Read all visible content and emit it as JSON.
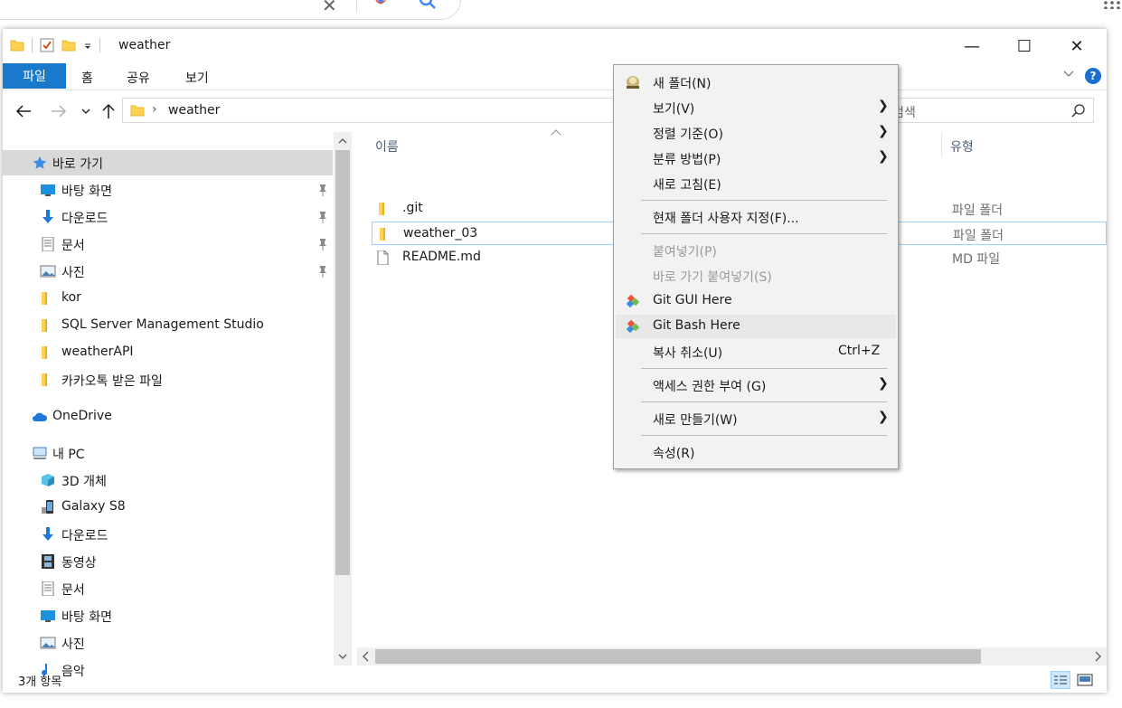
{
  "window": {
    "title": "weather",
    "minimize": "—",
    "maximize": "☐",
    "close": "✕"
  },
  "ribbon": {
    "tabs": [
      "파일",
      "홈",
      "공유",
      "보기"
    ],
    "help": "?"
  },
  "address": {
    "crumb": "weather",
    "search_placeholder": "ther 검색"
  },
  "nav_pane": {
    "quick_access": "바로 가기",
    "items": [
      {
        "label": "바탕 화면",
        "icon": "desktop-icon",
        "pinned": true
      },
      {
        "label": "다운로드",
        "icon": "download-arrow-icon",
        "pinned": true
      },
      {
        "label": "문서",
        "icon": "document-icon",
        "pinned": true
      },
      {
        "label": "사진",
        "icon": "picture-icon",
        "pinned": true
      },
      {
        "label": "kor",
        "icon": "folder-icon",
        "pinned": false
      },
      {
        "label": "SQL Server Management Studio",
        "icon": "folder-icon",
        "pinned": false
      },
      {
        "label": "weatherAPI",
        "icon": "folder-icon",
        "pinned": false
      },
      {
        "label": "카카오톡 받은 파일",
        "icon": "folder-icon",
        "pinned": false
      }
    ],
    "onedrive": "OneDrive",
    "this_pc": "내 PC",
    "pc_items": [
      {
        "label": "3D 개체",
        "icon": "cube-3d-icon"
      },
      {
        "label": "Galaxy S8",
        "icon": "phone-icon"
      },
      {
        "label": "다운로드",
        "icon": "download-arrow-icon"
      },
      {
        "label": "동영상",
        "icon": "film-icon"
      },
      {
        "label": "문서",
        "icon": "document-icon"
      },
      {
        "label": "바탕 화면",
        "icon": "desktop-icon"
      },
      {
        "label": "사진",
        "icon": "picture-icon"
      },
      {
        "label": "음악",
        "icon": "music-icon"
      }
    ]
  },
  "content": {
    "col_name": "이름",
    "col_type": "유형",
    "files": [
      {
        "name": ".git",
        "type": "파일 폴더",
        "icon": "folder-icon"
      },
      {
        "name": "weather_03",
        "type": "파일 폴더",
        "icon": "folder-icon"
      },
      {
        "name": "README.md",
        "type": "MD 파일",
        "icon": "file-icon"
      }
    ]
  },
  "status": {
    "count": "3개 항목"
  },
  "context_menu": {
    "items": [
      {
        "label": "새 폴더(N)",
        "icon": "new-folder-icon",
        "submenu": false,
        "disabled": false,
        "shortcut": ""
      },
      {
        "label": "보기(V)",
        "icon": "",
        "submenu": true,
        "disabled": false,
        "shortcut": ""
      },
      {
        "label": "정렬 기준(O)",
        "icon": "",
        "submenu": true,
        "disabled": false,
        "shortcut": ""
      },
      {
        "label": "분류 방법(P)",
        "icon": "",
        "submenu": true,
        "disabled": false,
        "shortcut": ""
      },
      {
        "label": "새로 고침(E)",
        "icon": "",
        "submenu": false,
        "disabled": false,
        "shortcut": ""
      },
      {
        "label": "현재 폴더 사용자 지정(F)...",
        "icon": "",
        "submenu": false,
        "disabled": false,
        "shortcut": ""
      },
      {
        "label": "붙여넣기(P)",
        "icon": "",
        "submenu": false,
        "disabled": true,
        "shortcut": ""
      },
      {
        "label": "바로 가기 붙여넣기(S)",
        "icon": "",
        "submenu": false,
        "disabled": true,
        "shortcut": ""
      },
      {
        "label": "Git GUI Here",
        "icon": "git-icon",
        "submenu": false,
        "disabled": false,
        "shortcut": ""
      },
      {
        "label": "Git Bash Here",
        "icon": "git-icon",
        "submenu": false,
        "disabled": false,
        "shortcut": ""
      },
      {
        "label": "복사 취소(U)",
        "icon": "",
        "submenu": false,
        "disabled": false,
        "shortcut": "Ctrl+Z"
      },
      {
        "label": "액세스 권한 부여 (G)",
        "icon": "",
        "submenu": true,
        "disabled": false,
        "shortcut": ""
      },
      {
        "label": "새로 만들기(W)",
        "icon": "",
        "submenu": true,
        "disabled": false,
        "shortcut": ""
      },
      {
        "label": "속성(R)",
        "icon": "",
        "submenu": false,
        "disabled": false,
        "shortcut": ""
      }
    ],
    "submenu_arrow": "❯"
  },
  "colors": {
    "accent": "#1979ca",
    "folder": "#ffd253",
    "selection": "#d9d9d9"
  }
}
